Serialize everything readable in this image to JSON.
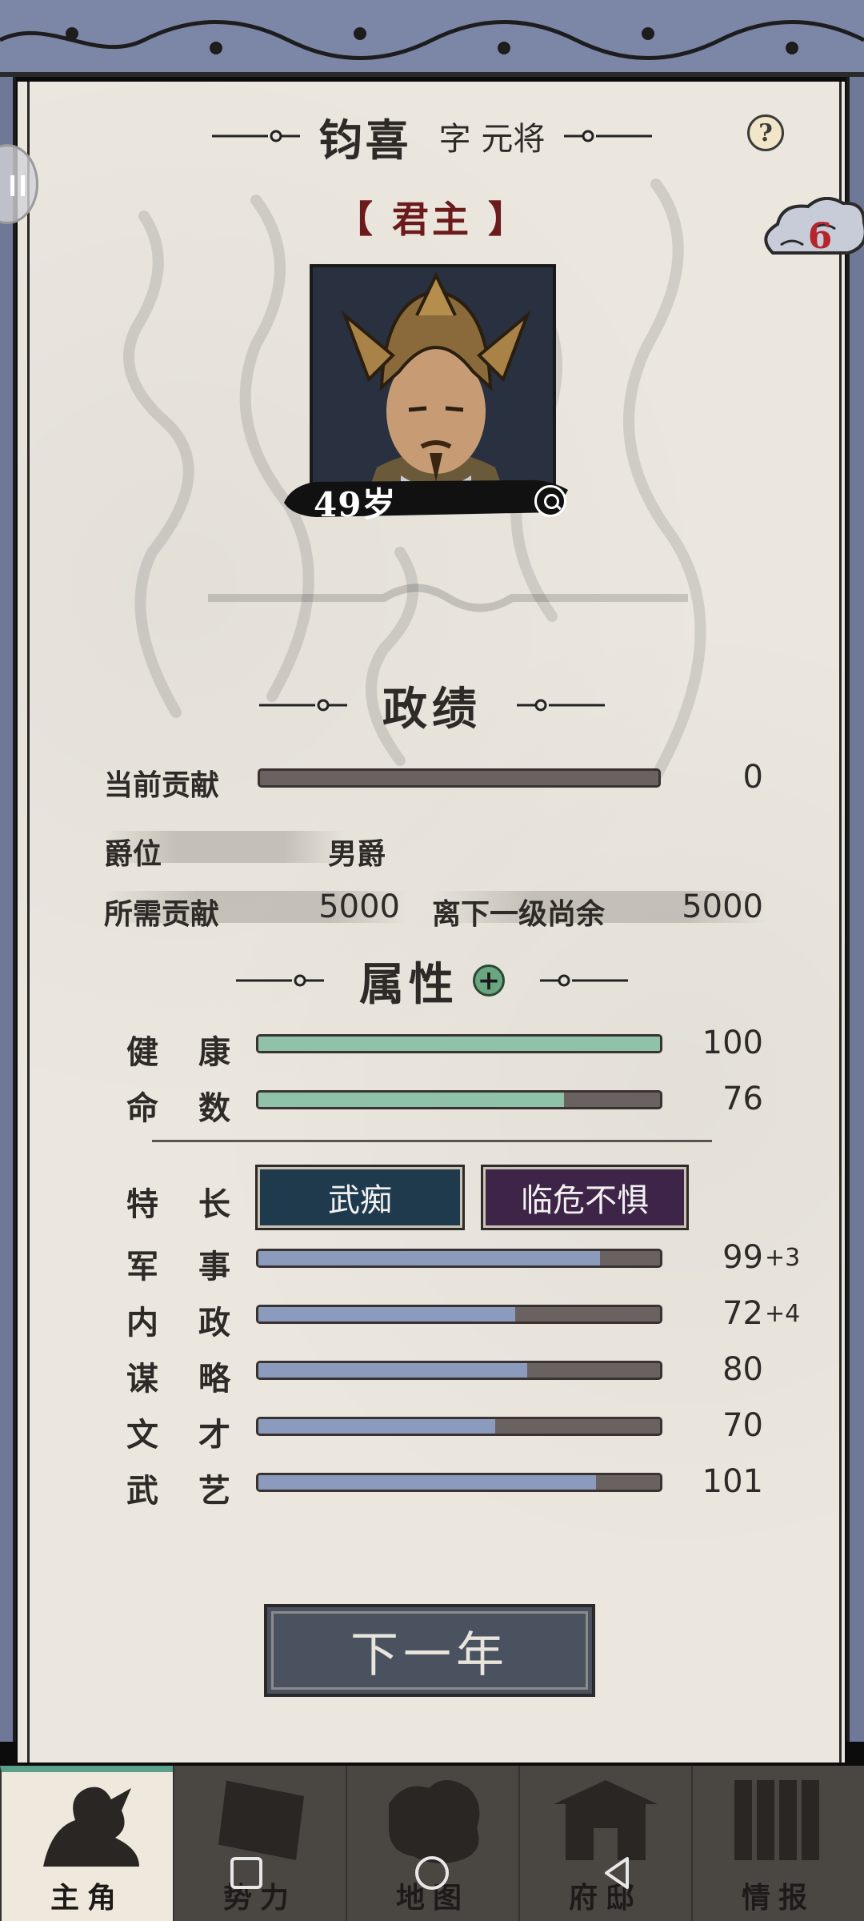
{
  "header": {
    "name": "钧喜",
    "style_label": "字 元将",
    "help_icon": "?",
    "rank": "【 君主 】",
    "badge_count": "6"
  },
  "portrait": {
    "age": "49岁",
    "icon": "magnifier-icon"
  },
  "merit": {
    "title": "政绩",
    "current_label": "当前贡献",
    "current_value": "0",
    "current_fraction": 0.0,
    "title_rank_label": "爵位",
    "title_rank_value": "男爵",
    "required_label": "所需贡献",
    "required_value": "5000",
    "remaining_label": "离下一级尚余",
    "remaining_value": "5000"
  },
  "attributes": {
    "title": "属性",
    "health": {
      "c1": "健",
      "c2": "康",
      "value": "100",
      "fraction": 1.0
    },
    "fate": {
      "c1": "命",
      "c2": "数",
      "value": "76",
      "fraction": 0.76
    },
    "specialty": {
      "c1": "特",
      "c2": "长"
    },
    "traits": [
      "武痴",
      "临危不惧"
    ],
    "stats": [
      {
        "c1": "军",
        "c2": "事",
        "value": "99",
        "bonus": "+3",
        "fraction": 0.85
      },
      {
        "c1": "内",
        "c2": "政",
        "value": "72",
        "bonus": "+4",
        "fraction": 0.64
      },
      {
        "c1": "谋",
        "c2": "略",
        "value": "80",
        "bonus": "",
        "fraction": 0.67
      },
      {
        "c1": "文",
        "c2": "才",
        "value": "70",
        "bonus": "",
        "fraction": 0.59
      },
      {
        "c1": "武",
        "c2": "艺",
        "value": "101",
        "bonus": "",
        "fraction": 0.84
      }
    ]
  },
  "next_button": "下一年",
  "nav": [
    {
      "label": "主角",
      "icon": "hero-icon",
      "active": true
    },
    {
      "label": "势力",
      "icon": "faction-icon",
      "active": false
    },
    {
      "label": "地图",
      "icon": "map-icon",
      "active": false
    },
    {
      "label": "府邸",
      "icon": "mansion-icon",
      "active": false
    },
    {
      "label": "情报",
      "icon": "intel-icon",
      "active": false
    }
  ],
  "colors": {
    "health_fill": "#8fc2a8",
    "stat_fill": "#8b9bbd",
    "track": "#6a6260",
    "trait_blue": "#1f3a4d",
    "trait_purple": "#3e2447"
  }
}
